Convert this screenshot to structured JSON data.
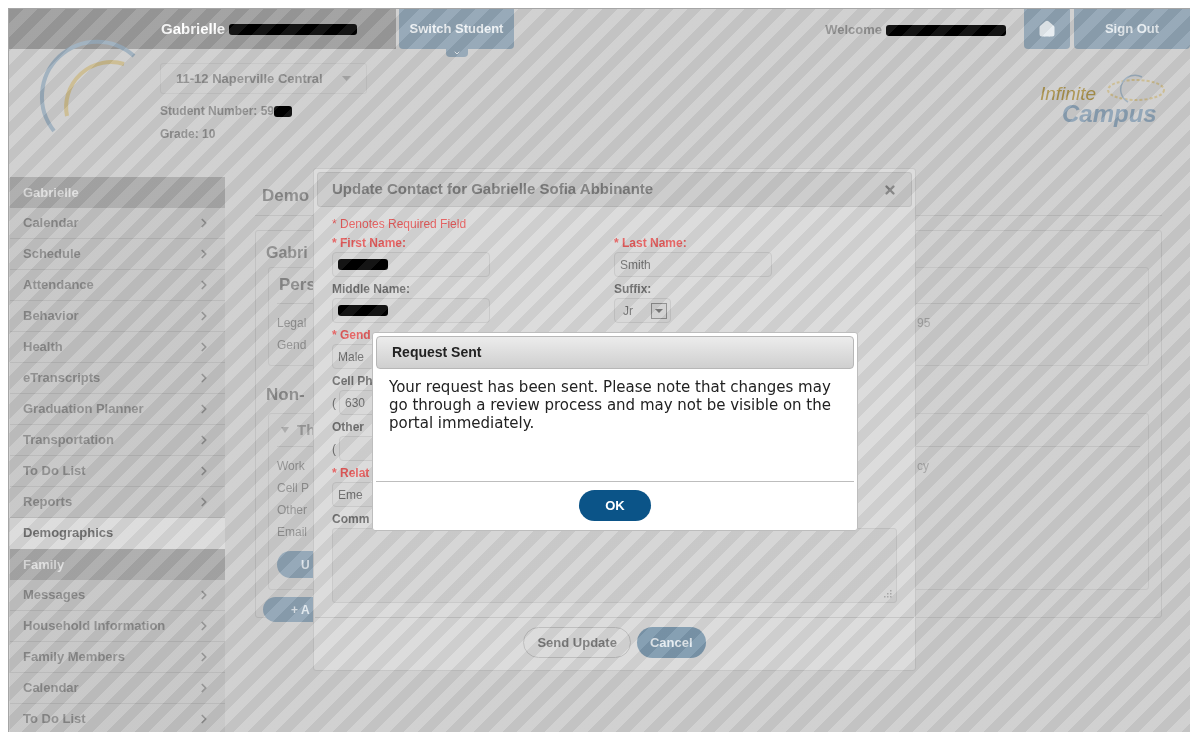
{
  "header": {
    "student_name": "Gabrielle",
    "switch_button": "Switch Student",
    "school_select": "11-12 Naperville Central",
    "student_number": "Student Number: 59",
    "grade": "Grade: 10",
    "welcome": "Welcome",
    "sign_out": "Sign Out",
    "logo": {
      "line1": "Infinite",
      "line2": "Campus"
    }
  },
  "sidebar": {
    "items": [
      {
        "label": "Gabrielle",
        "kind": "group"
      },
      {
        "label": "Calendar",
        "kind": "link",
        "selected": false
      },
      {
        "label": "Schedule",
        "kind": "link",
        "selected": false
      },
      {
        "label": "Attendance",
        "kind": "link",
        "selected": false
      },
      {
        "label": "Behavior",
        "kind": "link",
        "selected": false
      },
      {
        "label": "Health",
        "kind": "link",
        "selected": false
      },
      {
        "label": "eTranscripts",
        "kind": "link",
        "selected": false
      },
      {
        "label": "Graduation Planner",
        "kind": "link",
        "selected": false
      },
      {
        "label": "Transportation",
        "kind": "link",
        "selected": false
      },
      {
        "label": "To Do List",
        "kind": "link",
        "selected": false
      },
      {
        "label": "Reports",
        "kind": "link",
        "selected": false
      },
      {
        "label": "Demographics",
        "kind": "link",
        "selected": true
      },
      {
        "label": "Family",
        "kind": "group"
      },
      {
        "label": "Messages",
        "kind": "link",
        "selected": false
      },
      {
        "label": "Household Information",
        "kind": "link",
        "selected": false
      },
      {
        "label": "Family Members",
        "kind": "link",
        "selected": false
      },
      {
        "label": "Calendar",
        "kind": "link",
        "selected": false
      },
      {
        "label": "To Do List",
        "kind": "link",
        "selected": false
      }
    ]
  },
  "main": {
    "heading": "Demo",
    "section_title": "Gabri",
    "personal_panel": {
      "title": "Pers",
      "rows": [
        "Legal",
        "Gend"
      ],
      "value_fragment": "95"
    },
    "non_household": {
      "title": "Non-",
      "contact": {
        "title": "Th",
        "expanded": true,
        "rows": [
          "Work",
          "Cell P",
          "Other",
          "Email"
        ],
        "value_fragment": "cy",
        "button": "U"
      }
    },
    "add_button": "+ A"
  },
  "update_dialog": {
    "title": "Update Contact for Gabrielle Sofia Abbinante",
    "required_note": "* Denotes Required Field",
    "first_name": {
      "label": "* First Name:",
      "required": true,
      "redacted": true
    },
    "last_name": {
      "label": "* Last Name:",
      "required": true,
      "value": "Smith"
    },
    "middle_name": {
      "label": "Middle Name:",
      "required": false,
      "redacted": true
    },
    "suffix": {
      "label": "Suffix:",
      "required": false,
      "value": "Jr"
    },
    "gender": {
      "label": "* Gend",
      "required": true,
      "value": "Male"
    },
    "cell_phone": {
      "label": "Cell Ph",
      "required": false,
      "prefix": "(",
      "value": "630"
    },
    "other_phone": {
      "label": "Other",
      "required": false,
      "prefix": "("
    },
    "relationship": {
      "label": "* Relat",
      "required": true,
      "value": "Eme"
    },
    "comments": {
      "label": "Comm",
      "required": false
    },
    "buttons": [
      {
        "label": "Send Update",
        "kind": "secondary"
      },
      {
        "label": "Cancel",
        "kind": "primary"
      }
    ]
  },
  "alert": {
    "title": "Request Sent",
    "message": "Your request has been sent. Please note that changes may go through a review process and may not be visible on the portal immediately.",
    "button": "OK"
  }
}
